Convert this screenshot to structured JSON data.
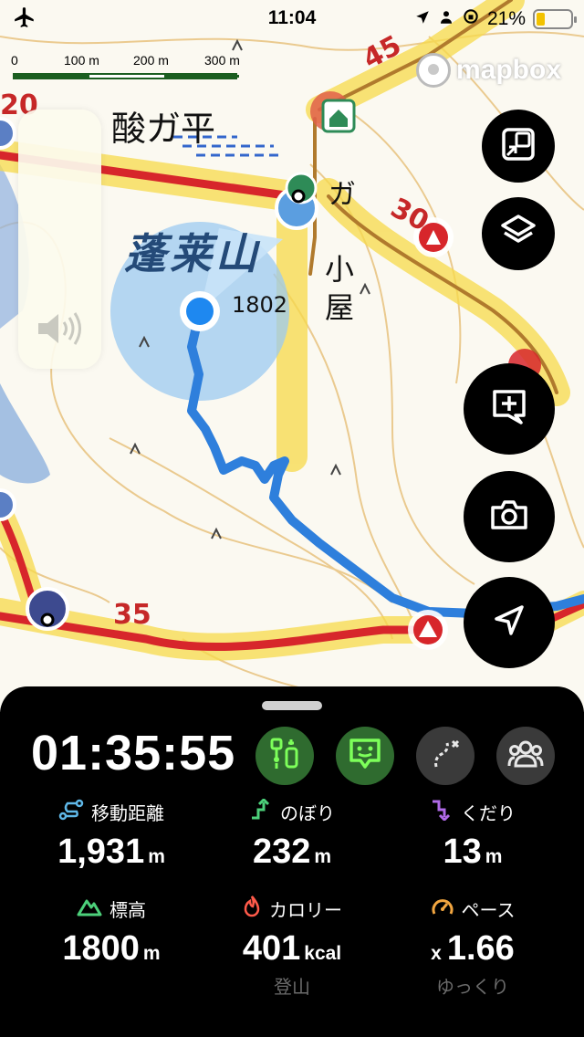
{
  "status": {
    "time": "11:04",
    "battery": "21%"
  },
  "map": {
    "scale_labels": [
      "0",
      "100 m",
      "200 m",
      "300 m"
    ],
    "brand": "mapbox",
    "place_1": "酸ガ平",
    "mountain": "蓬莱山",
    "elevation": "1802",
    "hut_1": "ガ",
    "hut_2": "小",
    "hut_3": "屋",
    "road_45": "45",
    "road_30": "30",
    "road_35": "35",
    "road_20": "20"
  },
  "panel": {
    "timer": "01:35:55",
    "stats": {
      "distance": {
        "label": "移動距離",
        "value": "1,931",
        "unit": "m"
      },
      "ascent": {
        "label": "のぼり",
        "value": "232",
        "unit": "m"
      },
      "descent": {
        "label": "くだり",
        "value": "13",
        "unit": "m"
      },
      "altitude": {
        "label": "標高",
        "value": "1800",
        "unit": "m"
      },
      "calories": {
        "label": "カロリー",
        "value": "401",
        "unit": "kcal",
        "sub": "登山"
      },
      "pace": {
        "label": "ペース",
        "prefix": "x",
        "value": "1.66",
        "sub": "ゆっくり"
      }
    }
  },
  "colors": {
    "accent_green": "#2f6b2f",
    "track_blue": "#2e7fdc",
    "road_red": "#d7262b",
    "road_yellow": "#f7d94a"
  }
}
